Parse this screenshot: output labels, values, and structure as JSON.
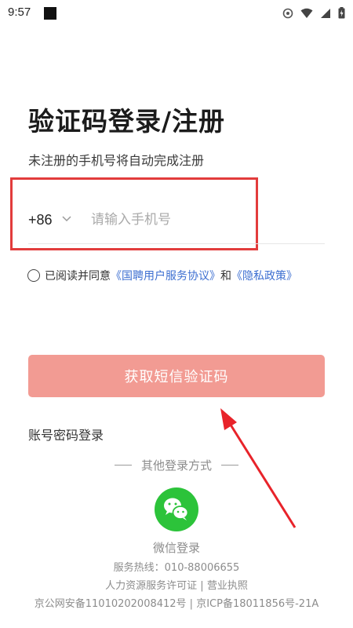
{
  "status_bar": {
    "time": "9:57"
  },
  "login": {
    "title": "验证码登录/注册",
    "subtitle": "未注册的手机号将自动完成注册",
    "country_code": "+86",
    "phone_placeholder": "请输入手机号",
    "agreement": {
      "prefix": "已阅读并同意",
      "service_link": "《国聘用户服务协议》",
      "and": "和",
      "privacy_link": "《隐私政策》"
    },
    "sms_button_label": "获取短信验证码",
    "account_login_label": "账号密码登录"
  },
  "other_login": {
    "label": "其他登录方式",
    "wechat_label": "微信登录"
  },
  "footer": {
    "hotline": "服务热线：010-88006655",
    "license": "人力资源服务许可证 | 营业执照",
    "record": "京公网安备11010202008412号 | 京ICP备18011856号-21A"
  },
  "colors": {
    "highlight_box": "#e23c3c",
    "button_bg": "#f29b93",
    "link": "#3d6fd1",
    "wechat": "#2cc33a",
    "arrow": "#e8232a"
  }
}
